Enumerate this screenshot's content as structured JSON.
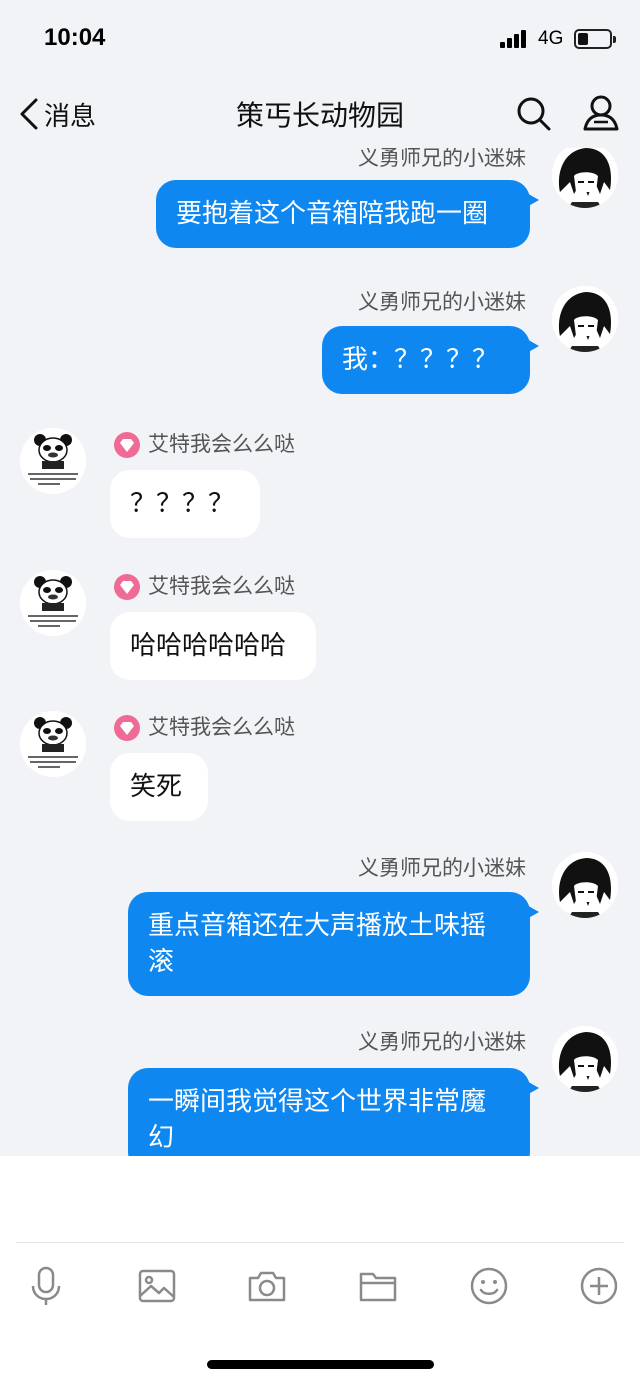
{
  "status_bar": {
    "time": "10:04",
    "network": "4G",
    "battery_icon": "battery-icon",
    "signal_icon": "signal-icon"
  },
  "nav": {
    "back_label": "消息",
    "title": "策丐长动物园",
    "back_icon": "chevron-left-icon",
    "search_icon": "search-icon",
    "profile_icon": "group-profile-icon"
  },
  "colors": {
    "outgoing_bubble": "#0f87f0",
    "incoming_bubble": "#ffffff",
    "background": "#f1f3f7",
    "badge": "#f06a96"
  },
  "messages": [
    {
      "direction": "out",
      "sender": "义勇师兄的小迷妹",
      "text": "要抱着这个音箱陪我跑一圈"
    },
    {
      "direction": "out",
      "sender": "义勇师兄的小迷妹",
      "text": "我：？？？？"
    },
    {
      "direction": "in",
      "sender": "艾特我会么么哒",
      "text": "？？？？"
    },
    {
      "direction": "in",
      "sender": "艾特我会么么哒",
      "text": "哈哈哈哈哈哈"
    },
    {
      "direction": "in",
      "sender": "艾特我会么么哒",
      "text": "笑死"
    },
    {
      "direction": "out",
      "sender": "义勇师兄的小迷妹",
      "text": "重点音箱还在大声播放土味摇滚"
    },
    {
      "direction": "out",
      "sender": "义勇师兄的小迷妹",
      "text": "一瞬间我觉得这个世界非常魔幻"
    }
  ],
  "input": {
    "placeholder": ""
  },
  "toolbar": [
    "microphone-icon",
    "image-icon",
    "camera-icon",
    "folder-icon",
    "emoji-icon",
    "plus-icon"
  ]
}
